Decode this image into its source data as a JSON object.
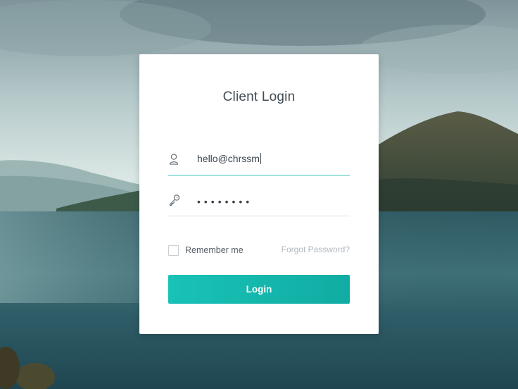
{
  "login": {
    "title": "Client Login",
    "email_value": "hello@chrssm",
    "password_mask": "••••••••",
    "remember_label": "Remember me",
    "forgot_label": "Forgot Password?",
    "button_label": "Login"
  },
  "icons": {
    "email": "user-icon",
    "password": "key-icon"
  },
  "colors": {
    "accent": "#1bb9ae",
    "title": "#3f4b55"
  }
}
